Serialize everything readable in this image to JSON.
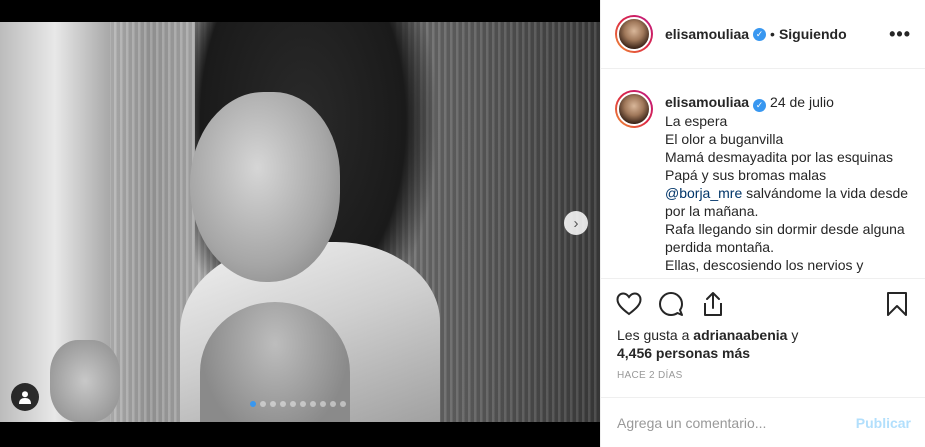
{
  "post": {
    "username": "elisamouliaa",
    "follow_status": "Siguiendo",
    "separator": "•",
    "more_label": "•••",
    "date": "24 de julio",
    "caption_lines": [
      "La espera",
      "El olor a buganvilla",
      "Mamá desmayadita por las esquinas",
      "Papá y sus bromas malas"
    ],
    "mention": "@borja_mre",
    "mention_rest": " salvándome la vida desde",
    "caption_lines_after": [
      "por la mañana.",
      "Rafa llegando sin dormir desde alguna",
      "perdida montaña.",
      "Ellas, descosiendo los nervios y"
    ],
    "likes_prefix": "Les gusta a ",
    "likes_user": "adrianaabenia",
    "likes_mid": " y",
    "likes_count": "4,456 personas más",
    "time_ago": "HACE 2 DÍAS",
    "comment_placeholder": "Agrega un comentario...",
    "publish_label": "Publicar"
  },
  "carousel": {
    "total": 10,
    "current": 1,
    "next_glyph": "›"
  },
  "colors": {
    "verified": "#3897f0",
    "publish": "#b2dffc",
    "mention": "#003569"
  },
  "icons": [
    "heart-icon",
    "comment-icon",
    "share-icon",
    "bookmark-icon",
    "user-tag-icon",
    "chevron-right-icon",
    "verified-icon",
    "more-icon"
  ]
}
